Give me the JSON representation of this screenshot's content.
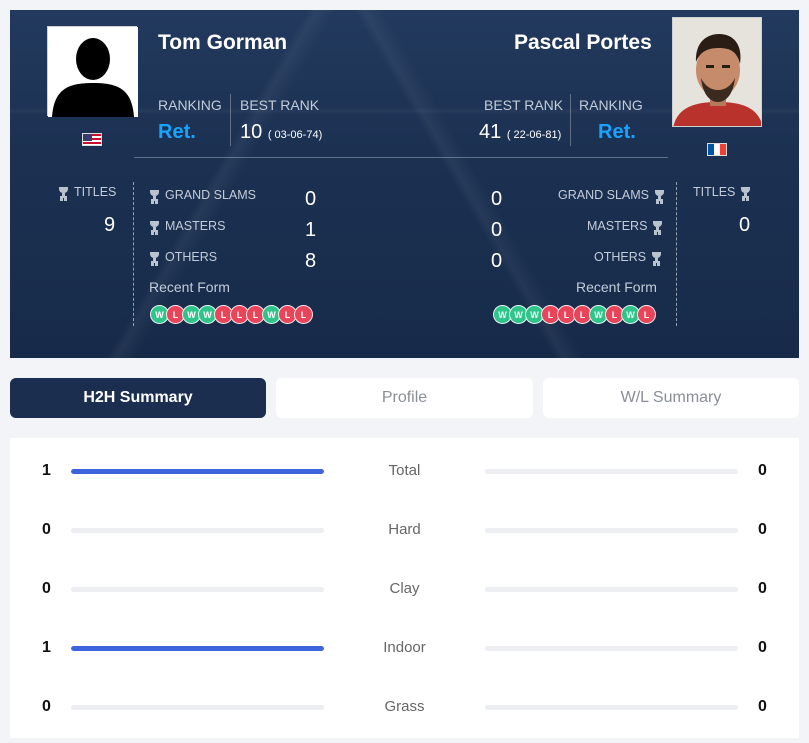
{
  "player1": {
    "name": "Tom Gorman",
    "flag": "us-flag",
    "ranking_label": "RANKING",
    "ranking": "Ret.",
    "best_rank_label": "BEST RANK",
    "best_rank": "10",
    "best_rank_date": "( 03-06-74)",
    "titles_label": "TITLES",
    "titles": "9",
    "grand_slams_label": "GRAND SLAMS",
    "grand_slams": "0",
    "masters_label": "MASTERS",
    "masters": "1",
    "others_label": "OTHERS",
    "others": "8",
    "recent_form_label": "Recent Form",
    "recent_form": [
      "W",
      "L",
      "W",
      "W",
      "L",
      "L",
      "L",
      "W",
      "L",
      "L"
    ]
  },
  "player2": {
    "name": "Pascal Portes",
    "flag": "fr-flag",
    "ranking_label": "RANKING",
    "ranking": "Ret.",
    "best_rank_label": "BEST RANK",
    "best_rank": "41",
    "best_rank_date": "( 22-06-81)",
    "titles_label": "TITLES",
    "titles": "0",
    "grand_slams_label": "GRAND SLAMS",
    "grand_slams": "0",
    "masters_label": "MASTERS",
    "masters": "0",
    "others_label": "OTHERS",
    "others": "0",
    "recent_form_label": "Recent Form",
    "recent_form": [
      "W",
      "W",
      "W",
      "L",
      "L",
      "L",
      "W",
      "L",
      "W",
      "L"
    ]
  },
  "tabs": [
    {
      "label": "H2H Summary",
      "active": true
    },
    {
      "label": "Profile",
      "active": false
    },
    {
      "label": "W/L Summary",
      "active": false
    }
  ],
  "h2h": [
    {
      "category": "Total",
      "left": "1",
      "right": "0",
      "left_share": 1.0,
      "right_share": 0.0
    },
    {
      "category": "Hard",
      "left": "0",
      "right": "0",
      "left_share": 0.0,
      "right_share": 0.0
    },
    {
      "category": "Clay",
      "left": "0",
      "right": "0",
      "left_share": 0.0,
      "right_share": 0.0
    },
    {
      "category": "Indoor",
      "left": "1",
      "right": "0",
      "left_share": 1.0,
      "right_share": 0.0
    },
    {
      "category": "Grass",
      "left": "0",
      "right": "0",
      "left_share": 0.0,
      "right_share": 0.0
    }
  ],
  "colors": {
    "accent_blue": "#18a3ff",
    "bar_fill": "#3d63dd",
    "win": "#2ec48a",
    "loss": "#e8445a",
    "active_tab": "#1b2e4f"
  }
}
